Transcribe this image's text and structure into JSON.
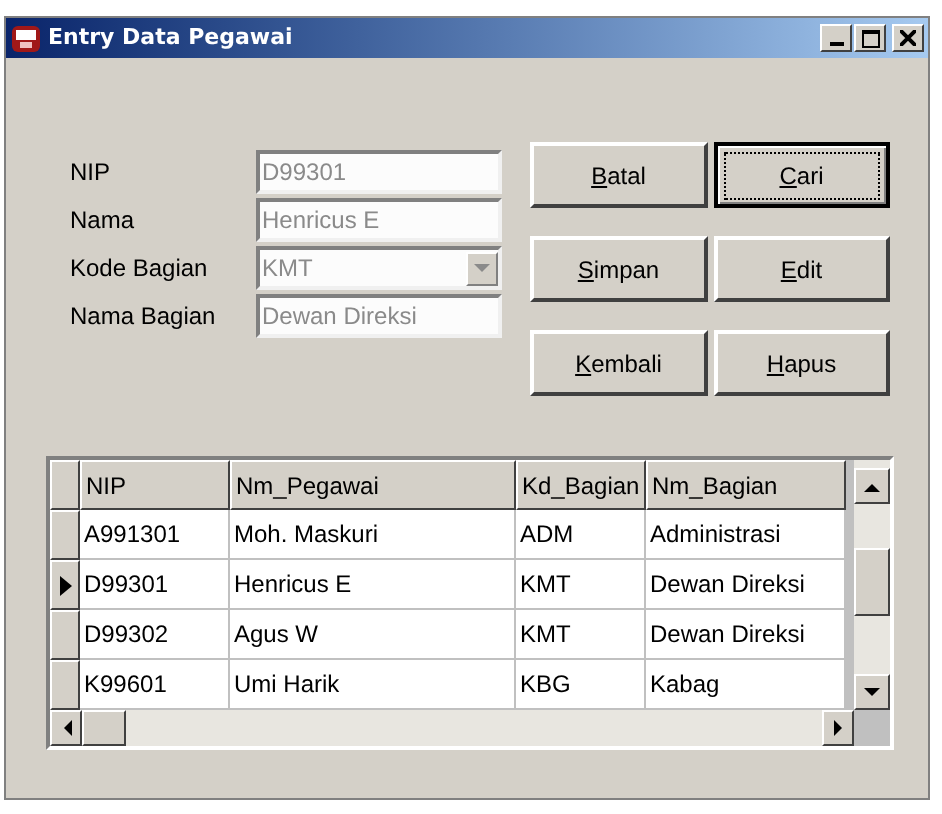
{
  "window": {
    "title": "Entry Data Pegawai"
  },
  "form": {
    "fields": [
      {
        "label": "NIP",
        "kind": "text",
        "value": "D99301",
        "disabled": true
      },
      {
        "label": "Nama",
        "kind": "text",
        "value": "Henricus E",
        "disabled": true
      },
      {
        "label": "Kode Bagian",
        "kind": "combo",
        "value": "KMT",
        "disabled": true
      },
      {
        "label": "Nama Bagian",
        "kind": "text",
        "value": "Dewan Direksi",
        "disabled": true
      }
    ]
  },
  "buttons": [
    {
      "label": "Batal",
      "mnemonic": true,
      "default": false
    },
    {
      "label": "Cari",
      "mnemonic": true,
      "default": true
    },
    {
      "label": "Simpan",
      "mnemonic": true,
      "default": false
    },
    {
      "label": "Edit",
      "mnemonic": true,
      "default": false
    },
    {
      "label": "Kembali",
      "mnemonic": true,
      "default": false
    },
    {
      "label": "Hapus",
      "mnemonic": true,
      "default": false
    }
  ],
  "table": {
    "columns": [
      "NIP",
      "Nm_Pegawai",
      "Kd_Bagian",
      "Nm_Bagian"
    ],
    "rows": [
      {
        "cells": [
          "A991301",
          "Moh. Maskuri",
          "ADM",
          "Administrasi"
        ],
        "selected": false
      },
      {
        "cells": [
          "D99301",
          "Henricus E",
          "KMT",
          "Dewan Direksi"
        ],
        "selected": true
      },
      {
        "cells": [
          "D99302",
          "Agus W",
          "KMT",
          "Dewan Direksi"
        ],
        "selected": false
      },
      {
        "cells": [
          "K99601",
          "Umi Harik",
          "KBG",
          "Kabag"
        ],
        "selected": false
      }
    ]
  }
}
